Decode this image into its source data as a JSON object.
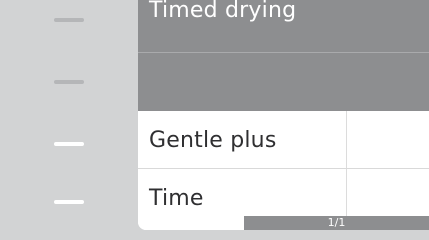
{
  "menu": {
    "items": [
      {
        "label": "Timed drying",
        "state": "selected"
      },
      {
        "label": "",
        "state": "selected"
      },
      {
        "label": "Gentle plus",
        "state": "normal"
      },
      {
        "label": "Time",
        "state": "normal"
      }
    ]
  },
  "pager": {
    "text": "1/1"
  },
  "colors": {
    "background": "#d2d3d4",
    "selected_row": "#8d8e90",
    "row": "#ffffff",
    "indicator_active": "#ffffff",
    "indicator_inactive": "#b5b6b8"
  }
}
